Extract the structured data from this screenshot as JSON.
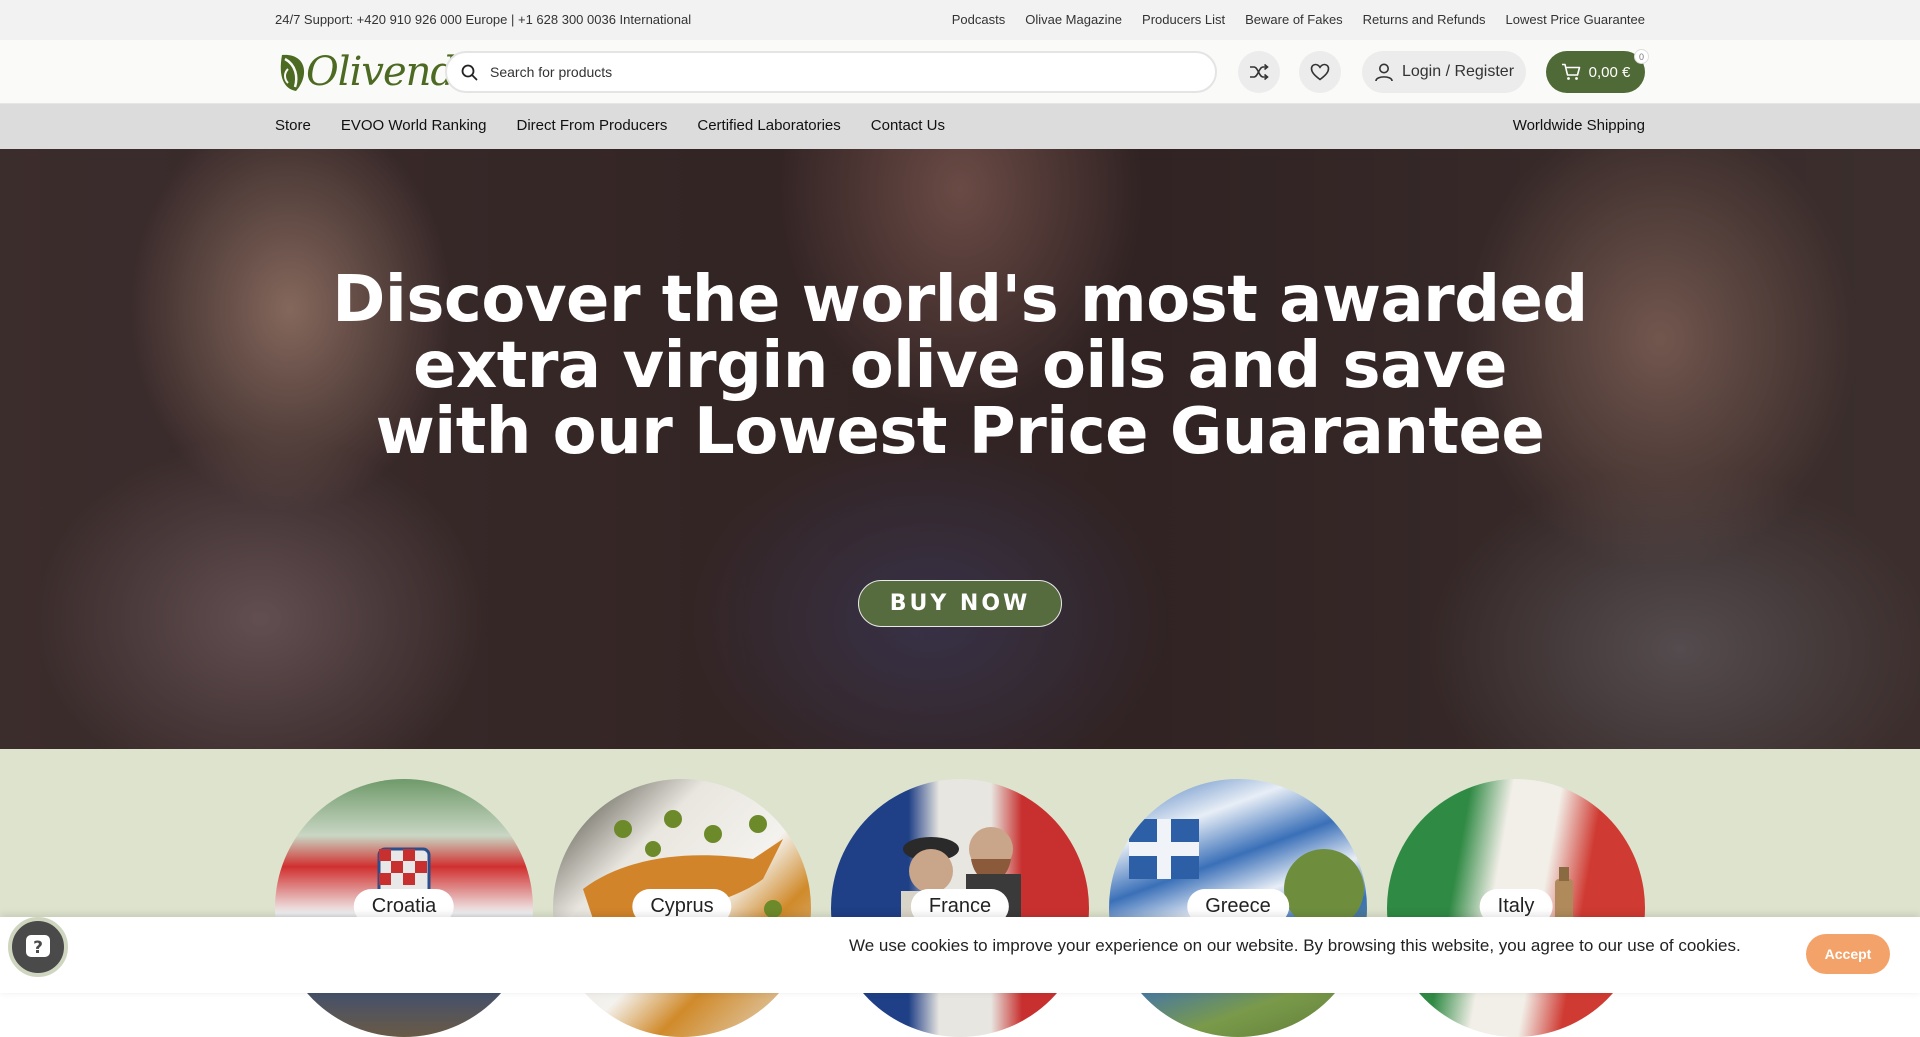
{
  "topbar": {
    "support": "24/7 Support: +420 910 926 000 Europe | +1 628 300 0036 International",
    "links": [
      "Podcasts",
      "Olivae Magazine",
      "Producers List",
      "Beware of Fakes",
      "Returns and Refunds",
      "Lowest Price Guarantee"
    ]
  },
  "header": {
    "logo_text": "Olivendo",
    "search_placeholder": "Search for products",
    "login_label": "Login / Register",
    "cart_total": "0,00 €",
    "cart_count": "0",
    "icons": [
      "search-icon",
      "shuffle-icon",
      "heart-icon",
      "user-icon",
      "cart-icon"
    ]
  },
  "nav": {
    "items": [
      "Store",
      "EVOO World Ranking",
      "Direct From Producers",
      "Certified Laboratories",
      "Contact Us"
    ],
    "right": "Worldwide Shipping"
  },
  "hero": {
    "headline": "Discover the world's most awarded extra virgin olive oils and save with our Lowest Price Guarantee",
    "button": "BUY NOW"
  },
  "countries": [
    "Croatia",
    "Cyprus",
    "France",
    "Greece",
    "Italy"
  ],
  "cookie": {
    "message": "We use cookies to improve your experience on our website. By browsing this website, you agree to our use of cookies.",
    "accept": "Accept"
  },
  "help": {
    "glyph": "?"
  },
  "colors": {
    "brand_green": "#4f6a36",
    "nav_bg": "#dcdcdc",
    "countries_bg": "#dde3cd",
    "accept": "#f3a36a"
  }
}
